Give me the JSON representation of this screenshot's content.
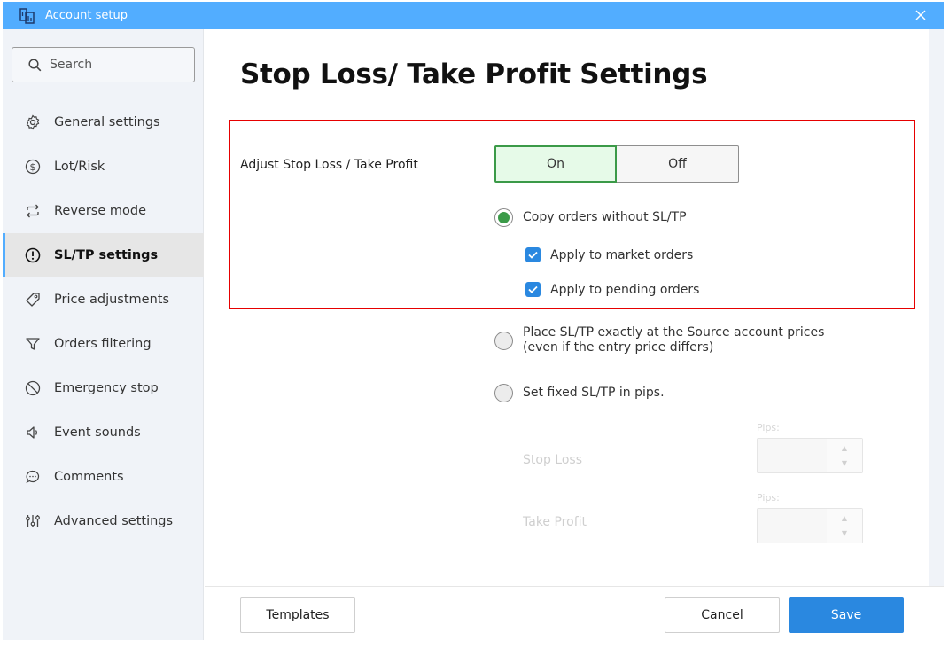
{
  "window": {
    "title": "Account setup"
  },
  "sidebar": {
    "search_placeholder": "Search",
    "items": [
      {
        "label": "General settings",
        "icon": "gear-icon",
        "active": false
      },
      {
        "label": "Lot/Risk",
        "icon": "dollar-circle-icon",
        "active": false
      },
      {
        "label": "Reverse mode",
        "icon": "repeat-icon",
        "active": false
      },
      {
        "label": "SL/TP settings",
        "icon": "exclamation-circle-icon",
        "active": true
      },
      {
        "label": "Price adjustments",
        "icon": "tag-icon",
        "active": false
      },
      {
        "label": "Orders filtering",
        "icon": "filter-icon",
        "active": false
      },
      {
        "label": "Emergency stop",
        "icon": "ban-icon",
        "active": false
      },
      {
        "label": "Event sounds",
        "icon": "speaker-icon",
        "active": false
      },
      {
        "label": "Comments",
        "icon": "chat-bubble-icon",
        "active": false
      },
      {
        "label": "Advanced settings",
        "icon": "sliders-icon",
        "active": false
      }
    ]
  },
  "main": {
    "title": "Stop Loss/ Take Profit Settings",
    "adjust": {
      "label": "Adjust Stop Loss / Take Profit",
      "on_label": "On",
      "off_label": "Off",
      "value": "On"
    },
    "options": [
      {
        "label": "Copy orders without SL/TP",
        "checked": true
      },
      {
        "label": "Place SL/TP exactly at the Source account prices",
        "sublabel": "(even if the entry price differs)",
        "checked": false
      },
      {
        "label": "Set fixed SL/TP in pips.",
        "checked": false
      }
    ],
    "checkboxes": [
      {
        "label": "Apply to market orders",
        "checked": true
      },
      {
        "label": "Apply to pending orders",
        "checked": true
      }
    ],
    "fixed": {
      "stop_loss_label": "Stop Loss",
      "take_profit_label": "Take Profit",
      "pips_label": "Pips:",
      "stop_loss_value": "",
      "take_profit_value": "",
      "up_arrow": "▲",
      "down_arrow": "▼"
    }
  },
  "footer": {
    "templates_label": "Templates",
    "cancel_label": "Cancel",
    "save_label": "Save"
  },
  "colors": {
    "titlebar": "#52adff",
    "accent_green": "#3b9a48",
    "primary_blue": "#2a88e0",
    "highlight_red": "#e60000"
  }
}
